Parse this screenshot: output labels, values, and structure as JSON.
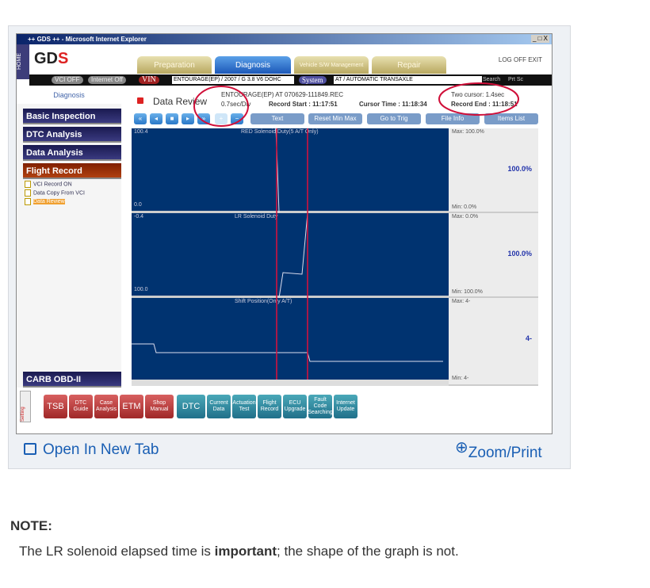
{
  "window": {
    "title": "++ GDS ++ - Microsoft Internet Explorer",
    "home": "HOME",
    "logo": "GDS",
    "controls": "_ □ X"
  },
  "tabs": [
    {
      "label": "Preparation"
    },
    {
      "label": "Diagnosis"
    },
    {
      "label": "Vehicle S/W Management"
    },
    {
      "label": "Repair"
    }
  ],
  "top_links": "LOG OFF  EXIT",
  "vehicle_bar": {
    "vci": "VCI OFF",
    "internet": "Internet Off",
    "vin_label": "VIN",
    "vin_value": "ENTOURAGE(EP) / 2007 / G 3.8 V6 DOHC",
    "system_label": "System",
    "system_value": "AT / AUTOMATIC TRANSAXLE",
    "search": "Search",
    "prtsc": "Prt Sc"
  },
  "sidebar": {
    "header": "Diagnosis",
    "items": [
      "Basic Inspection",
      "DTC Analysis",
      "Data Analysis",
      "Flight Record"
    ],
    "subitems": [
      "VCI Record ON",
      "Data Copy From VCI",
      "Data Review"
    ],
    "bottom": "CARB OBD-II"
  },
  "review": {
    "title": "Data Review",
    "file": "ENTOURAGE(EP) AT  070629-111849.REC",
    "scale": "0.7sec/Div",
    "record_start": "Record Start : 11:17:51",
    "cursor_time": "Cursor Time : 11:18:34",
    "two_cursor": "Two cursor: 1.4sec",
    "record_end": "Record End : 11:18:51"
  },
  "toolbar": {
    "text": "Text",
    "reset": "Reset Min Max",
    "trig": "Go to Trig",
    "fileinfo": "File Info",
    "items": "Items List"
  },
  "graphs": [
    {
      "name": "RED Solenoid Duty(5 A/T Only)",
      "top": "100.4",
      "bottom": "0.0",
      "max": "Max: 100.0%",
      "min": "Min:  0.0%",
      "value": "100.0%"
    },
    {
      "name": "LR Solenoid Duty",
      "top": "-0.4",
      "bottom": "100.0",
      "max": "Max:  0.0%",
      "min": "Min: 100.0%",
      "value": "100.0%"
    },
    {
      "name": "Shift Position(Only A/T)",
      "max": "Max: 4-",
      "min": "Min: 4-",
      "value": "4-"
    }
  ],
  "bottom_buttons": {
    "setting": "Setting",
    "red": [
      "TSB",
      "DTC Guide",
      "Case Analysis",
      "ETM",
      "Shop Manual"
    ],
    "teal": [
      "DTC",
      "Current Data",
      "Actuation Test",
      "Flight Record",
      "ECU Upgrade",
      "Fault Code Searching",
      "Internet Update"
    ]
  },
  "colors": {
    "annotation": "#d0103a",
    "link": "#1a5fb4"
  },
  "footer": {
    "open": "Open In New Tab",
    "zoom": "Zoom/Print"
  },
  "note": {
    "heading": "NOTE:",
    "pre": "The LR solenoid elapsed time is ",
    "bold": "important",
    "post": "; the shape of the graph is not."
  }
}
